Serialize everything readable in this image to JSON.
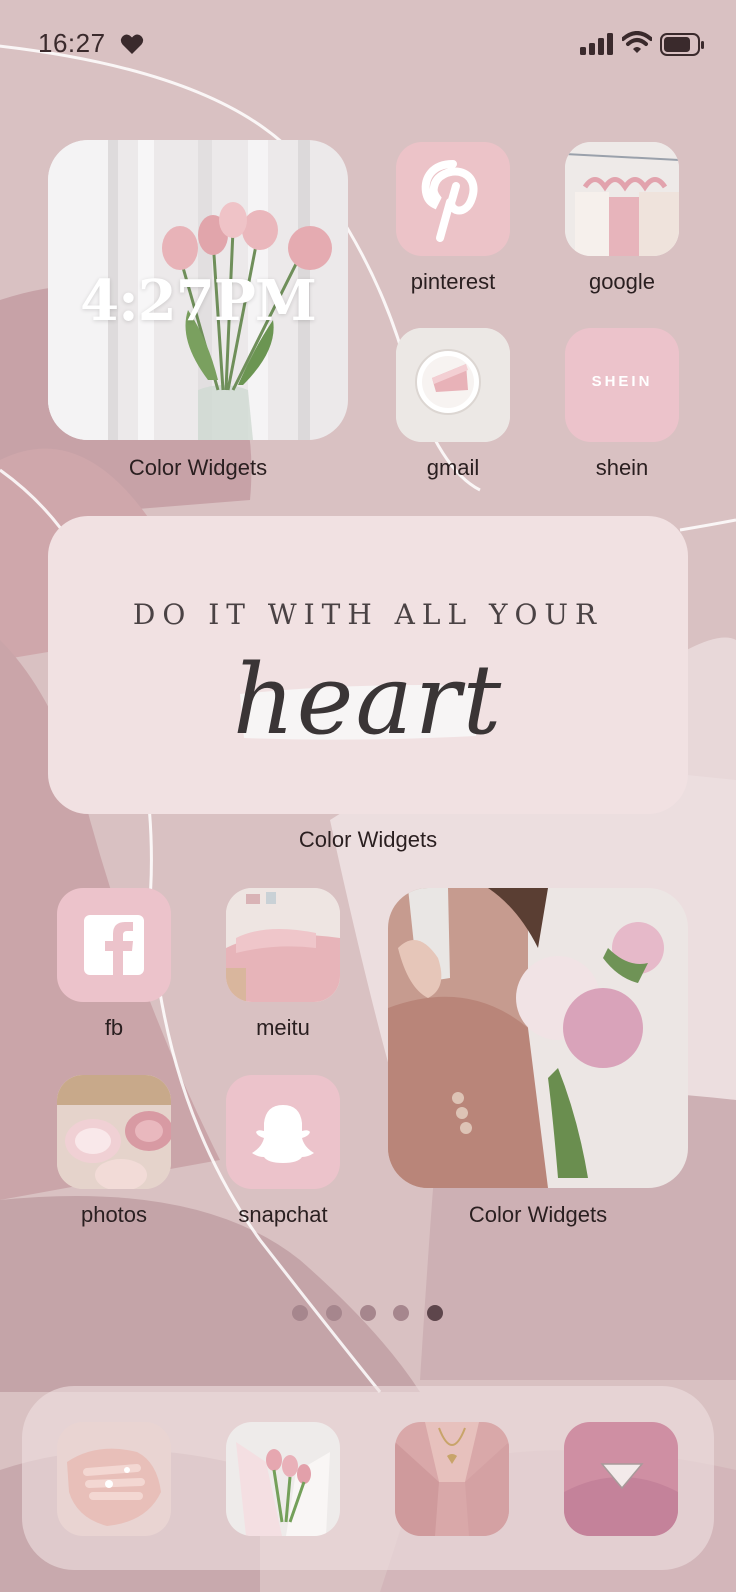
{
  "status_bar": {
    "time": "16:27"
  },
  "widgets": {
    "clock_widget": {
      "time": "4:27PM",
      "label": "Color Widgets"
    },
    "quote_widget": {
      "line1": "DO IT WITH ALL YOUR",
      "line2": "heart",
      "label": "Color Widgets"
    },
    "photo_widget": {
      "label": "Color Widgets"
    }
  },
  "apps": {
    "pinterest": "pinterest",
    "google": "google",
    "gmail": "gmail",
    "shein": "shein",
    "shein_logo": "SHEIN",
    "fb": "fb",
    "meitu": "meitu",
    "photos": "photos",
    "snapchat": "snapchat"
  },
  "page_indicator": {
    "count": 5,
    "active_index": 4
  },
  "colors": {
    "icon_pink": "#ecc3cb",
    "background": "#d9c1c2"
  }
}
